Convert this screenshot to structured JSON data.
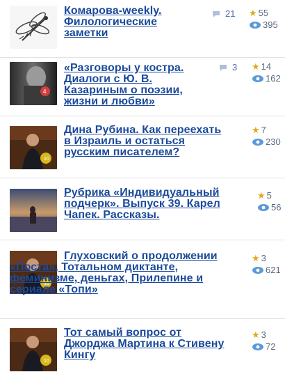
{
  "items": [
    {
      "title": "Комарова-weekly. Филологические заметки",
      "comments": "21",
      "rating": "55",
      "views": "395"
    },
    {
      "title": "«Разговоры у костра. Диалоги с Ю. В. Казариным о поэзии, жизни и любви»",
      "comments": "3",
      "rating": "14",
      "views": "162"
    },
    {
      "title": "Дина Рубина. Как переехать в Израиль и остаться русским писателем?",
      "rating": "7",
      "views": "230"
    },
    {
      "title": "Рубрика «Индивидуальный подчерк». Выпуск 39. Карел Чапек. Рассказы.",
      "rating": "5",
      "views": "56"
    },
    {
      "title": "Глуховский о продолжении «Поста», Тотальном диктанте, феминизме, деньгах, Прилепине и сериале «Топи»",
      "rating": "3",
      "views": "621"
    },
    {
      "title": "Тот самый вопрос от Джорджа Мартина к Стивену Кингу",
      "rating": "3",
      "views": "72"
    }
  ],
  "colors": {
    "link": "#1b4a9b",
    "star": "#e0a81a",
    "meta": "#5a6a80",
    "comment": "#4b6ea8"
  }
}
